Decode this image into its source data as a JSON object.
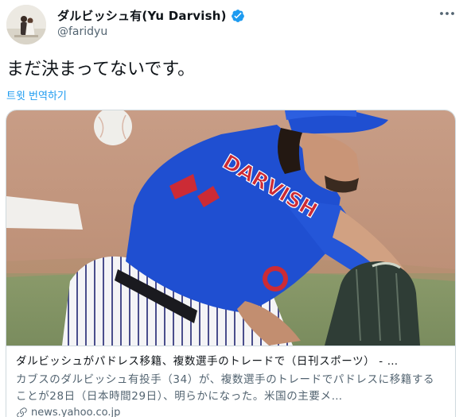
{
  "author": {
    "display_name": "ダルビッシュ有(Yu Darvish)",
    "handle": "@faridyu",
    "verified": true
  },
  "more_icon": "ellipsis-horizontal-icon",
  "tweet": {
    "text": "まだ決まってないです。",
    "translate_label": "트윗 번역하기"
  },
  "card": {
    "image_subject": "baseball-pitcher-photo",
    "jersey_text": "DARVISH",
    "title": "ダルビッシュがパドレス移籍、複数選手のトレードで（日刊スポーツ） - …",
    "description": "カブスのダルビッシュ有投手（34）が、複数選手のトレードでパドレスに移籍することが28日（日本時間29日）、明らかになった。米国の主要メ…",
    "domain": "news.yahoo.co.jp",
    "domain_icon": "link-icon"
  },
  "colors": {
    "link": "#1d9bf0",
    "verified": "#1d9bf0",
    "secondary_text": "#536471",
    "jersey_blue": "#1f4fd1",
    "jersey_red": "#cc2b35"
  }
}
